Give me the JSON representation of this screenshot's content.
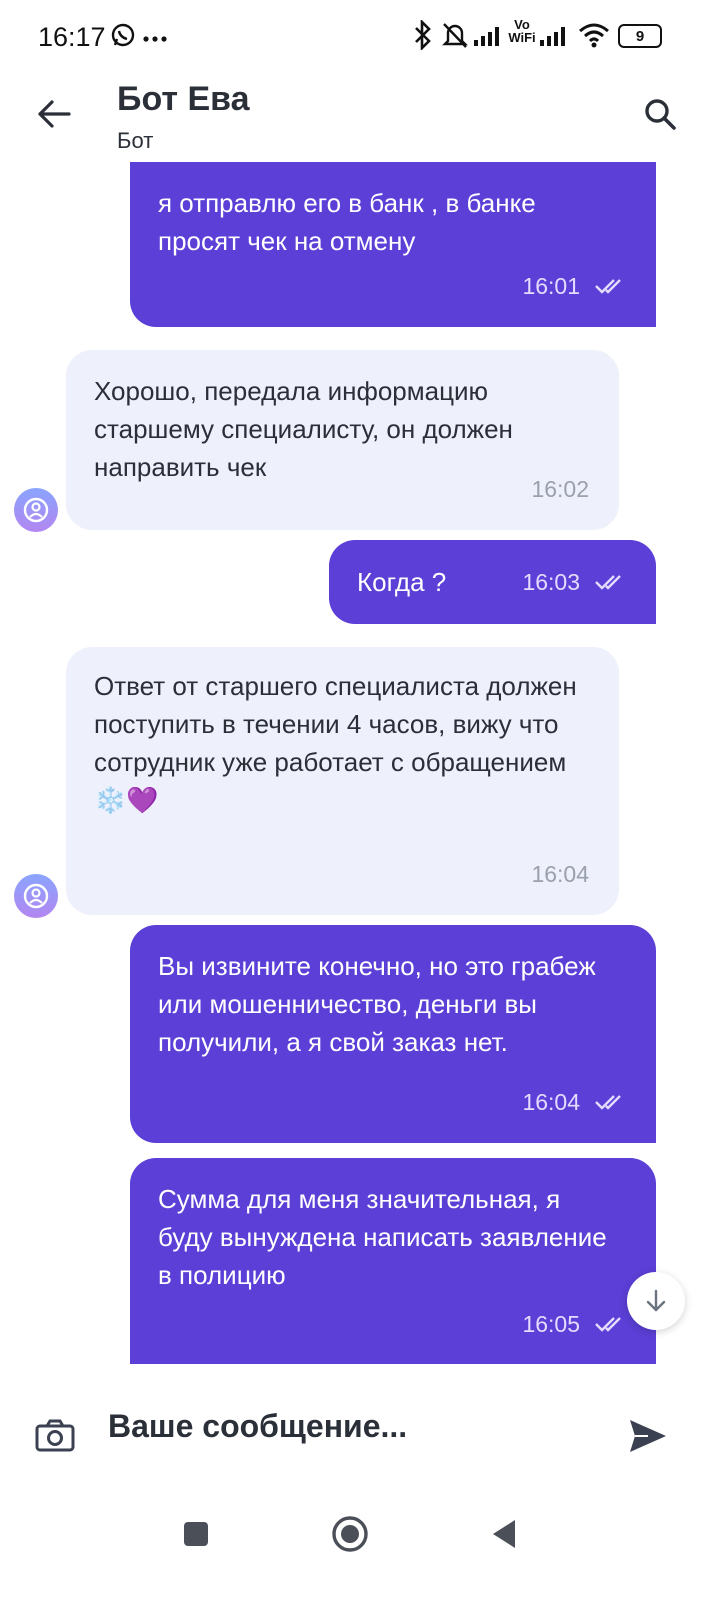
{
  "status_bar": {
    "time": "16:17",
    "notification_icons": [
      "whatsapp-icon",
      "more-dots-icon"
    ],
    "system_icons": [
      "bluetooth-icon",
      "bell-muted-icon",
      "signal-icon",
      "vowifi-icon",
      "signal-icon",
      "wifi-icon",
      "battery-icon"
    ],
    "vowifi_label": "Vo WiFi",
    "battery_level": "9"
  },
  "header": {
    "title": "Бот Ева",
    "subtitle": "Бот"
  },
  "messages": [
    {
      "direction": "out",
      "partial_text": "я отправлю его в банк , в банке просят чек на отмену",
      "time": "16:01",
      "status": "read"
    },
    {
      "direction": "in",
      "text": "Хорошо, передала информацию старшему специалисту, он должен направить чек",
      "time": "16:02"
    },
    {
      "direction": "out",
      "text": "Когда ?",
      "time": "16:03",
      "status": "read"
    },
    {
      "direction": "in",
      "text": "Ответ от старшего специалиста должен поступить в течении 4 часов, вижу что сотрудник уже работает с обращением ❄️💜",
      "time": "16:04"
    },
    {
      "direction": "out",
      "text": "Вы извините конечно, но это грабеж или мошенничество, деньги вы получили, а я свой заказ нет.",
      "time": "16:04",
      "status": "read"
    },
    {
      "direction": "out",
      "text": "Сумма для меня значительная, я буду вынуждена написать заявление в полицию",
      "time": "16:05",
      "status": "read"
    }
  ],
  "composer": {
    "placeholder": "Ваше сообщение..."
  },
  "colors": {
    "outgoing_bubble": "#5b3fd6",
    "incoming_bubble": "#eef0fb",
    "text": "#2b2f38"
  }
}
